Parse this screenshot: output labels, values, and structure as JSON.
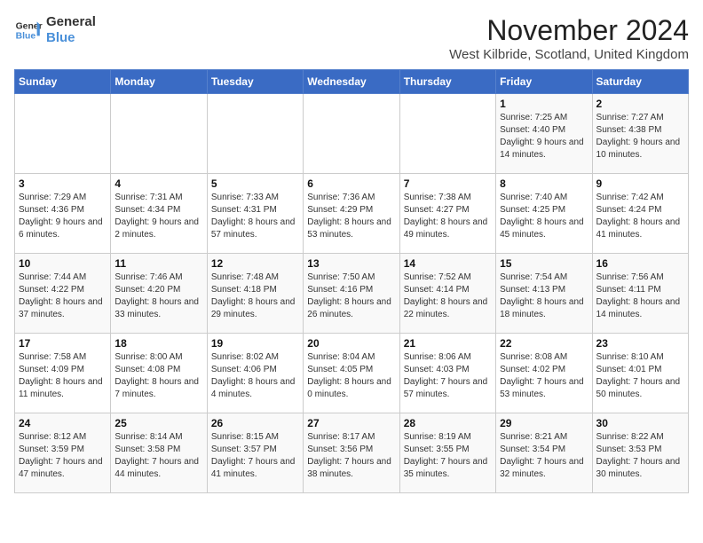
{
  "header": {
    "logo_general": "General",
    "logo_blue": "Blue",
    "month_title": "November 2024",
    "subtitle": "West Kilbride, Scotland, United Kingdom"
  },
  "weekdays": [
    "Sunday",
    "Monday",
    "Tuesday",
    "Wednesday",
    "Thursday",
    "Friday",
    "Saturday"
  ],
  "weeks": [
    [
      {
        "day": "",
        "info": ""
      },
      {
        "day": "",
        "info": ""
      },
      {
        "day": "",
        "info": ""
      },
      {
        "day": "",
        "info": ""
      },
      {
        "day": "",
        "info": ""
      },
      {
        "day": "1",
        "info": "Sunrise: 7:25 AM\nSunset: 4:40 PM\nDaylight: 9 hours and 14 minutes."
      },
      {
        "day": "2",
        "info": "Sunrise: 7:27 AM\nSunset: 4:38 PM\nDaylight: 9 hours and 10 minutes."
      }
    ],
    [
      {
        "day": "3",
        "info": "Sunrise: 7:29 AM\nSunset: 4:36 PM\nDaylight: 9 hours and 6 minutes."
      },
      {
        "day": "4",
        "info": "Sunrise: 7:31 AM\nSunset: 4:34 PM\nDaylight: 9 hours and 2 minutes."
      },
      {
        "day": "5",
        "info": "Sunrise: 7:33 AM\nSunset: 4:31 PM\nDaylight: 8 hours and 57 minutes."
      },
      {
        "day": "6",
        "info": "Sunrise: 7:36 AM\nSunset: 4:29 PM\nDaylight: 8 hours and 53 minutes."
      },
      {
        "day": "7",
        "info": "Sunrise: 7:38 AM\nSunset: 4:27 PM\nDaylight: 8 hours and 49 minutes."
      },
      {
        "day": "8",
        "info": "Sunrise: 7:40 AM\nSunset: 4:25 PM\nDaylight: 8 hours and 45 minutes."
      },
      {
        "day": "9",
        "info": "Sunrise: 7:42 AM\nSunset: 4:24 PM\nDaylight: 8 hours and 41 minutes."
      }
    ],
    [
      {
        "day": "10",
        "info": "Sunrise: 7:44 AM\nSunset: 4:22 PM\nDaylight: 8 hours and 37 minutes."
      },
      {
        "day": "11",
        "info": "Sunrise: 7:46 AM\nSunset: 4:20 PM\nDaylight: 8 hours and 33 minutes."
      },
      {
        "day": "12",
        "info": "Sunrise: 7:48 AM\nSunset: 4:18 PM\nDaylight: 8 hours and 29 minutes."
      },
      {
        "day": "13",
        "info": "Sunrise: 7:50 AM\nSunset: 4:16 PM\nDaylight: 8 hours and 26 minutes."
      },
      {
        "day": "14",
        "info": "Sunrise: 7:52 AM\nSunset: 4:14 PM\nDaylight: 8 hours and 22 minutes."
      },
      {
        "day": "15",
        "info": "Sunrise: 7:54 AM\nSunset: 4:13 PM\nDaylight: 8 hours and 18 minutes."
      },
      {
        "day": "16",
        "info": "Sunrise: 7:56 AM\nSunset: 4:11 PM\nDaylight: 8 hours and 14 minutes."
      }
    ],
    [
      {
        "day": "17",
        "info": "Sunrise: 7:58 AM\nSunset: 4:09 PM\nDaylight: 8 hours and 11 minutes."
      },
      {
        "day": "18",
        "info": "Sunrise: 8:00 AM\nSunset: 4:08 PM\nDaylight: 8 hours and 7 minutes."
      },
      {
        "day": "19",
        "info": "Sunrise: 8:02 AM\nSunset: 4:06 PM\nDaylight: 8 hours and 4 minutes."
      },
      {
        "day": "20",
        "info": "Sunrise: 8:04 AM\nSunset: 4:05 PM\nDaylight: 8 hours and 0 minutes."
      },
      {
        "day": "21",
        "info": "Sunrise: 8:06 AM\nSunset: 4:03 PM\nDaylight: 7 hours and 57 minutes."
      },
      {
        "day": "22",
        "info": "Sunrise: 8:08 AM\nSunset: 4:02 PM\nDaylight: 7 hours and 53 minutes."
      },
      {
        "day": "23",
        "info": "Sunrise: 8:10 AM\nSunset: 4:01 PM\nDaylight: 7 hours and 50 minutes."
      }
    ],
    [
      {
        "day": "24",
        "info": "Sunrise: 8:12 AM\nSunset: 3:59 PM\nDaylight: 7 hours and 47 minutes."
      },
      {
        "day": "25",
        "info": "Sunrise: 8:14 AM\nSunset: 3:58 PM\nDaylight: 7 hours and 44 minutes."
      },
      {
        "day": "26",
        "info": "Sunrise: 8:15 AM\nSunset: 3:57 PM\nDaylight: 7 hours and 41 minutes."
      },
      {
        "day": "27",
        "info": "Sunrise: 8:17 AM\nSunset: 3:56 PM\nDaylight: 7 hours and 38 minutes."
      },
      {
        "day": "28",
        "info": "Sunrise: 8:19 AM\nSunset: 3:55 PM\nDaylight: 7 hours and 35 minutes."
      },
      {
        "day": "29",
        "info": "Sunrise: 8:21 AM\nSunset: 3:54 PM\nDaylight: 7 hours and 32 minutes."
      },
      {
        "day": "30",
        "info": "Sunrise: 8:22 AM\nSunset: 3:53 PM\nDaylight: 7 hours and 30 minutes."
      }
    ]
  ]
}
